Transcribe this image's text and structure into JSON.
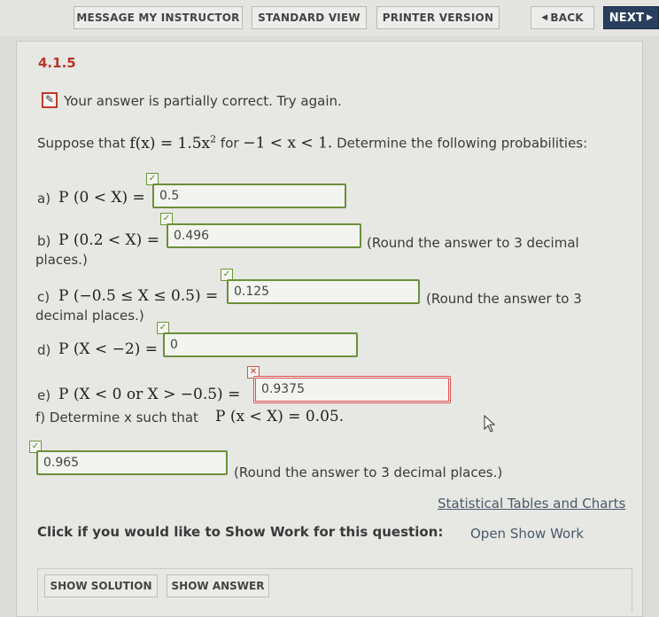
{
  "toolbar": {
    "message_instructor": "MESSAGE MY INSTRUCTOR",
    "standard_view": "STANDARD VIEW",
    "printer_version": "PRINTER VERSION",
    "back": "BACK",
    "next": "NEXT"
  },
  "question": {
    "number": "4.1.5",
    "feedback": "Your answer is partially correct.  Try again.",
    "intro_prefix": "Suppose that",
    "function": "f(x) = 1.5x",
    "exponent": "2",
    "for_text": "for",
    "domain": "−1 < x < 1.",
    "intro_suffix": "Determine the following probabilities:"
  },
  "parts": {
    "a": {
      "label": "a)",
      "expr": "P (0 < X) =",
      "answer": "0.5",
      "status": "correct"
    },
    "b": {
      "label": "b)",
      "expr": "P (0.2 < X) =",
      "answer": "0.496",
      "note": "(Round the answer to 3 decimal",
      "note2": "places.)",
      "status": "correct"
    },
    "c": {
      "label": "c)",
      "expr": "P (−0.5 ≤ X ≤ 0.5) =",
      "answer": "0.125",
      "note": "(Round the answer to 3",
      "note2": "decimal places.)",
      "status": "correct"
    },
    "d": {
      "label": "d)",
      "expr": "P (X < −2) =",
      "answer": "0",
      "status": "correct"
    },
    "e": {
      "label": "e)",
      "expr": "P (X < 0 or X > −0.5) =",
      "answer": "0.9375",
      "status": "incorrect"
    },
    "f": {
      "label": "f) Determine x such that",
      "expr": "P (x < X) = 0.05.",
      "answer": "0.965",
      "note": "(Round the answer to 3 decimal places.)",
      "status": "correct"
    }
  },
  "links": {
    "tables": "Statistical Tables and Charts",
    "show_work_prompt": "Click if you would like to Show Work for this question:",
    "open_show_work": "Open Show Work"
  },
  "bottom": {
    "show_solution": "SHOW SOLUTION",
    "show_answer": "SHOW ANSWER"
  },
  "icons": {
    "check": "✓",
    "x": "✕",
    "pencil": "✎"
  }
}
